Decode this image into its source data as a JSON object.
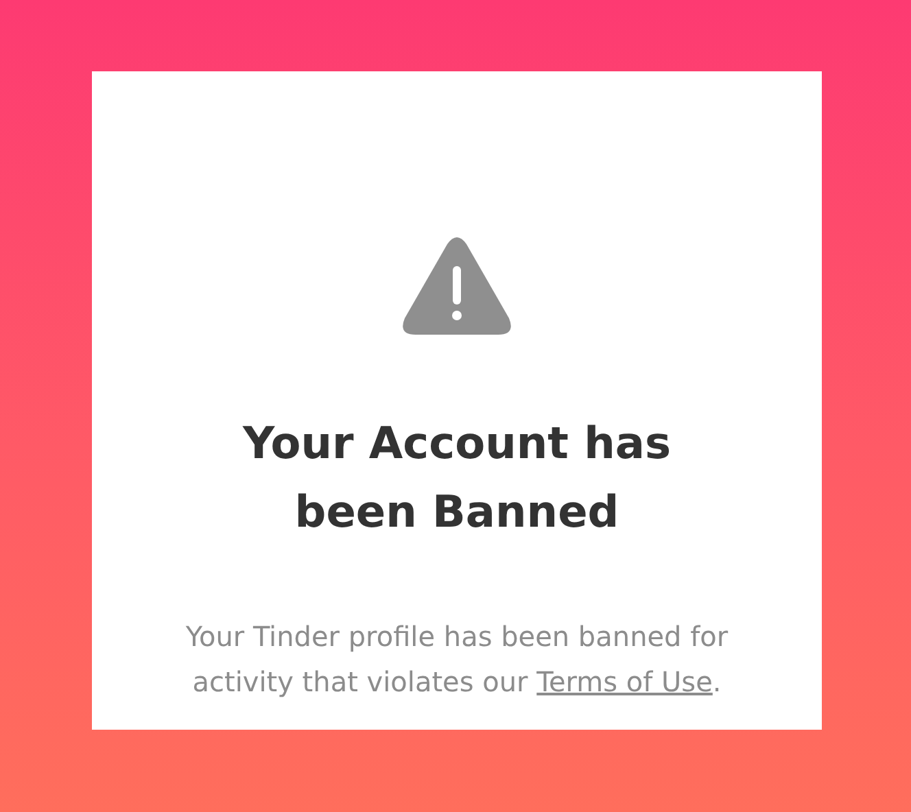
{
  "dialog": {
    "title": "Your Account has been Banned",
    "message": {
      "text": "Your Tinder profile has been banned for activity that violates our ",
      "link": "Terms of Use",
      "suffix": "."
    }
  }
}
